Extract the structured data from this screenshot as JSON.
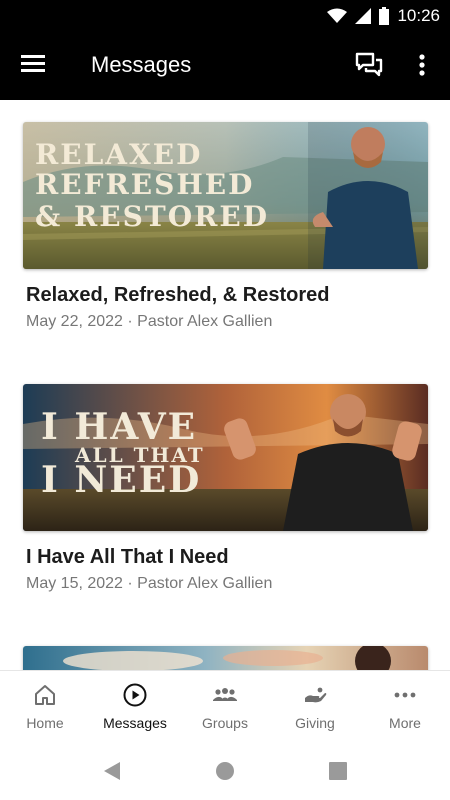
{
  "status_bar": {
    "time": "10:26",
    "icons": [
      "wifi-icon",
      "signal-icon",
      "battery-icon"
    ]
  },
  "app_bar": {
    "title": "Messages",
    "icons": [
      "menu-icon",
      "chat-icon",
      "more-vert-icon"
    ]
  },
  "messages": [
    {
      "banner_lines": [
        "RELAXED",
        "REFRESHED",
        "& RESTORED"
      ],
      "title": "Relaxed, Refreshed, & Restored",
      "subtitle": "May 22, 2022 · Pastor Alex Gallien"
    },
    {
      "banner_lines": [
        "I HAVE",
        "ALL THAT",
        "I NEED"
      ],
      "title": "I Have All That I Need",
      "subtitle": "May 15, 2022 · Pastor Alex Gallien"
    }
  ],
  "bottom_nav": {
    "items": [
      {
        "label": "Home",
        "icon": "home-icon",
        "active": false
      },
      {
        "label": "Messages",
        "icon": "play-circle-icon",
        "active": true
      },
      {
        "label": "Groups",
        "icon": "groups-icon",
        "active": false
      },
      {
        "label": "Giving",
        "icon": "giving-icon",
        "active": false
      },
      {
        "label": "More",
        "icon": "more-horiz-icon",
        "active": false
      }
    ]
  },
  "system_nav": [
    "back-icon",
    "home-circle-icon",
    "recents-icon"
  ],
  "colors": {
    "bar_background": "#000000",
    "active_nav": "#111111",
    "inactive_nav": "#6f6f6f",
    "subtitle": "#777777"
  }
}
